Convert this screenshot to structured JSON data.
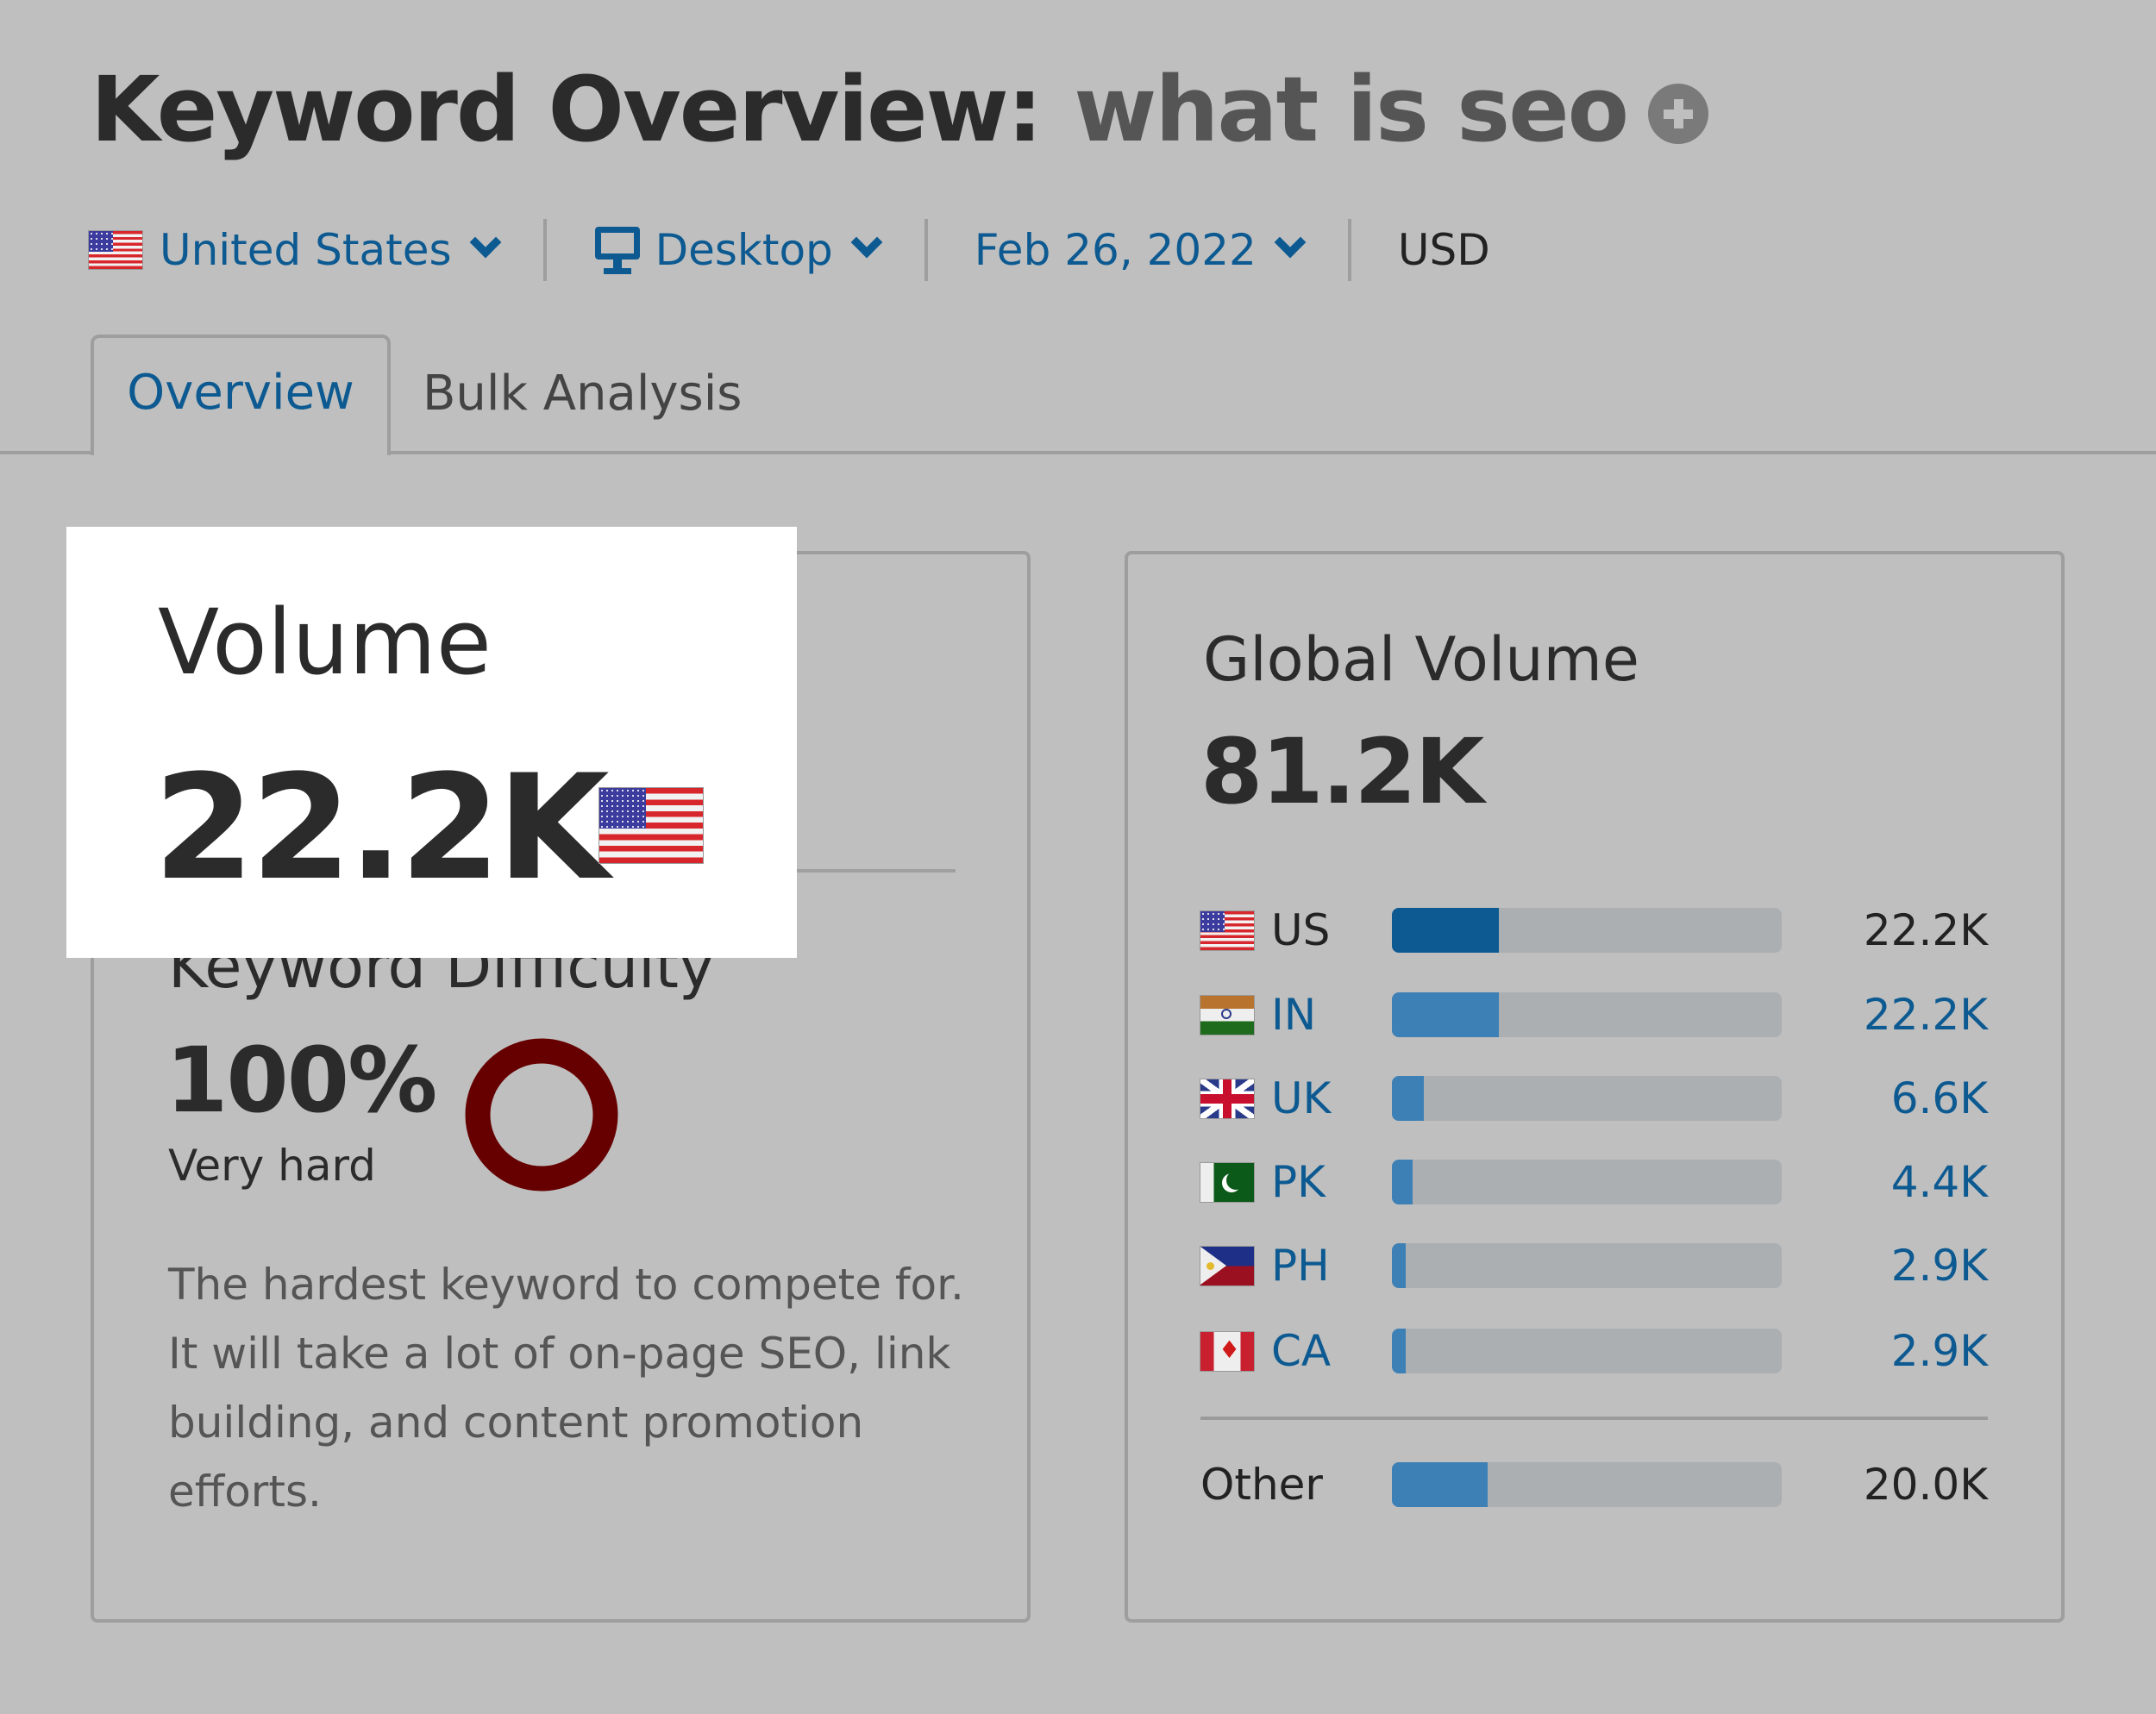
{
  "header": {
    "title_prefix": "Keyword Overview:",
    "keyword": "what is seo",
    "add_icon": "plus-circle-icon"
  },
  "filters": {
    "country": {
      "label": "United States",
      "icon": "us-flag-icon"
    },
    "device": {
      "label": "Desktop",
      "icon": "desktop-monitor-icon"
    },
    "date": {
      "label": "Feb 26, 2022"
    },
    "currency": "USD"
  },
  "tabs": [
    {
      "label": "Overview",
      "active": true
    },
    {
      "label": "Bulk Analysis",
      "active": false
    }
  ],
  "volume": {
    "label": "Volume",
    "value": "22.2K",
    "flag": "us-flag-icon"
  },
  "keyword_difficulty": {
    "label": "Keyword Difficulty",
    "value": "100%",
    "percent": 100,
    "level": "Very hard",
    "color": "#660000",
    "description": "The hardest keyword to compete for. It will take a lot of on-page SEO, link building, and content promotion efforts."
  },
  "global_volume": {
    "label": "Global Volume",
    "value": "81.2K",
    "total": 81.2,
    "countries": [
      {
        "code": "US",
        "value": "22.2K",
        "amount": 22.2,
        "flag": "us-flag-icon",
        "highlight": true
      },
      {
        "code": "IN",
        "value": "22.2K",
        "amount": 22.2,
        "flag": "india-flag-icon"
      },
      {
        "code": "UK",
        "value": "6.6K",
        "amount": 6.6,
        "flag": "uk-flag-icon"
      },
      {
        "code": "PK",
        "value": "4.4K",
        "amount": 4.4,
        "flag": "pakistan-flag-icon"
      },
      {
        "code": "PH",
        "value": "2.9K",
        "amount": 2.9,
        "flag": "philippines-flag-icon"
      },
      {
        "code": "CA",
        "value": "2.9K",
        "amount": 2.9,
        "flag": "canada-flag-icon"
      }
    ],
    "other": {
      "label": "Other",
      "value": "20.0K",
      "amount": 20.0
    }
  },
  "colors": {
    "accent": "#0c5a91",
    "bar_fill": "#3d80b6",
    "bar_fill_selected": "#0c5a91",
    "bar_track": "#abafb2",
    "background": "#bfbfbf"
  }
}
